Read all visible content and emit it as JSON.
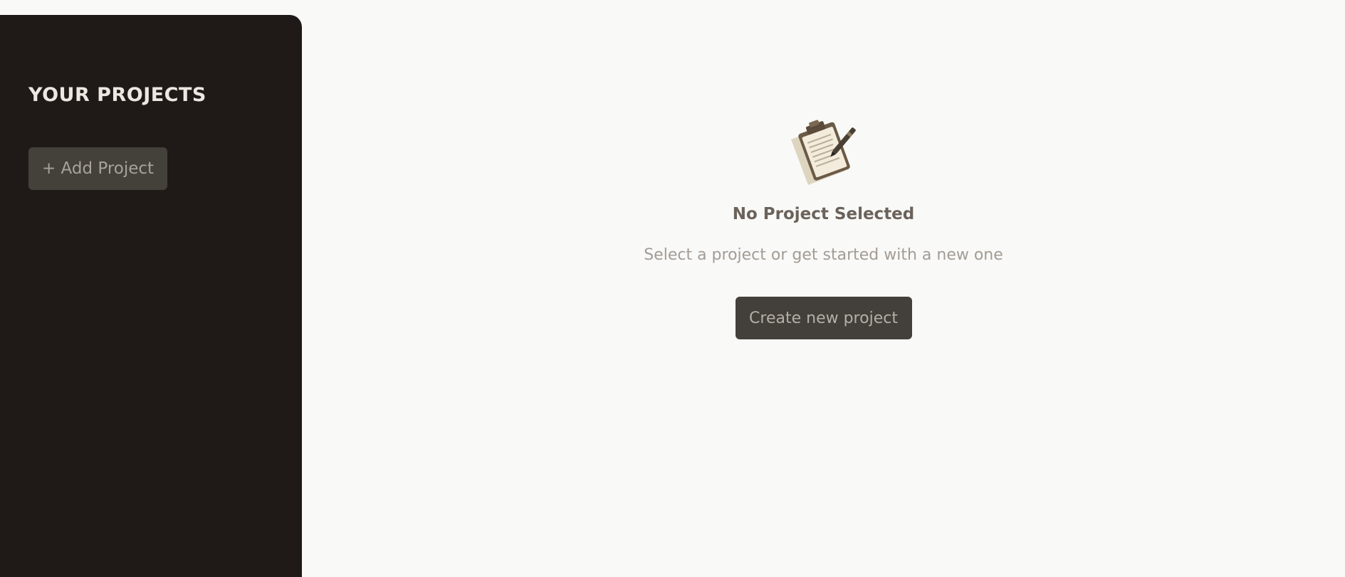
{
  "sidebar": {
    "title": "YOUR PROJECTS",
    "add_project_label": "+ Add Project"
  },
  "main": {
    "empty_state": {
      "icon": "clipboard-icon",
      "title": "No Project Selected",
      "subtitle": "Select a project or get started with a new one",
      "create_button_label": "Create new project"
    }
  },
  "colors": {
    "sidebar_background": "#1f1a17",
    "page_background": "#f9f9f7",
    "button_background": "#433f3a"
  }
}
